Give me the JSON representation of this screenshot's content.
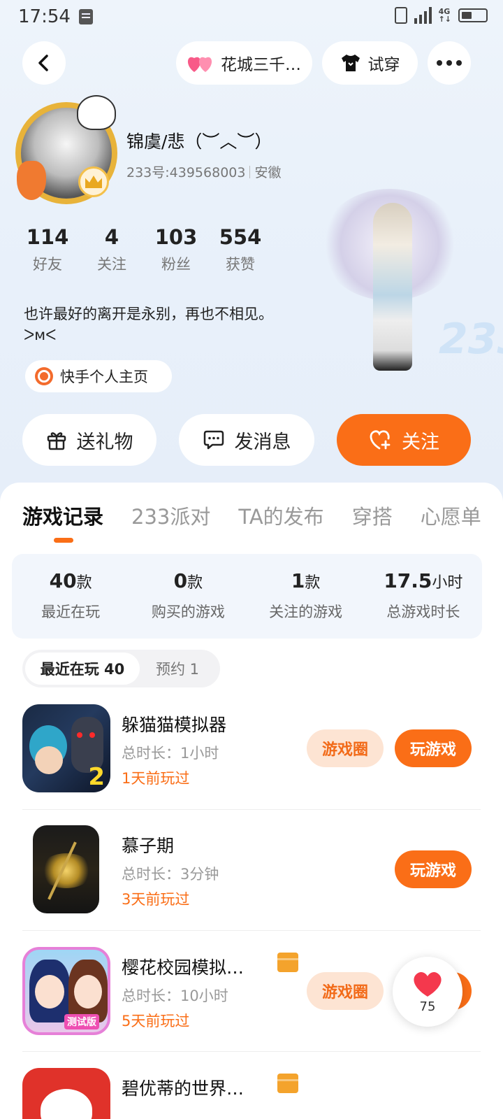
{
  "status_bar": {
    "time": "17:54"
  },
  "header": {
    "friend_name": "花城三千…",
    "try_on_label": "试穿"
  },
  "profile": {
    "username": "锦虞/悲（︶︿︶）",
    "id_text": "233号:439568003",
    "location": "安徽",
    "stats": [
      {
        "value": "114",
        "label": "好友"
      },
      {
        "value": "4",
        "label": "关注"
      },
      {
        "value": "103",
        "label": "粉丝"
      },
      {
        "value": "554",
        "label": "获赞"
      }
    ],
    "bio_line1": "也许最好的离开是永别，再也不相见。",
    "bio_line2": "ᐳᴍᐸ",
    "kuaishou_label": "快手个人主页",
    "gift_label": "送礼物",
    "message_label": "发消息",
    "follow_label": "关注"
  },
  "tabs": [
    "游戏记录",
    "233派对",
    "TA的发布",
    "穿搭",
    "心愿单"
  ],
  "summary": [
    {
      "value": "40",
      "unit": "款",
      "label": "最近在玩"
    },
    {
      "value": "0",
      "unit": "款",
      "label": "购买的游戏"
    },
    {
      "value": "1",
      "unit": "款",
      "label": "关注的游戏"
    },
    {
      "value": "17.5",
      "unit": "小时",
      "label": "总游戏时长"
    }
  ],
  "subtabs": {
    "recent": "最近在玩 40",
    "reserve": "预约 1"
  },
  "games": [
    {
      "title": "躲猫猫模拟器",
      "duration": "总时长：1小时",
      "last_played": "1天前玩过",
      "circle_label": "游戏圈",
      "play_label": "玩游戏"
    },
    {
      "title": "慕子期",
      "duration": "总时长：3分钟",
      "last_played": "3天前玩过",
      "play_label": "玩游戏"
    },
    {
      "title": "樱花校园模拟…",
      "duration": "总时长：10小时",
      "last_played": "5天前玩过",
      "circle_label": "游戏圈",
      "play_label": "玩游戏"
    },
    {
      "title": "碧优蒂的世界…"
    }
  ],
  "like_count": "75",
  "colors": {
    "accent": "#fa6e17",
    "hero_bg": "#e9f1fa"
  }
}
